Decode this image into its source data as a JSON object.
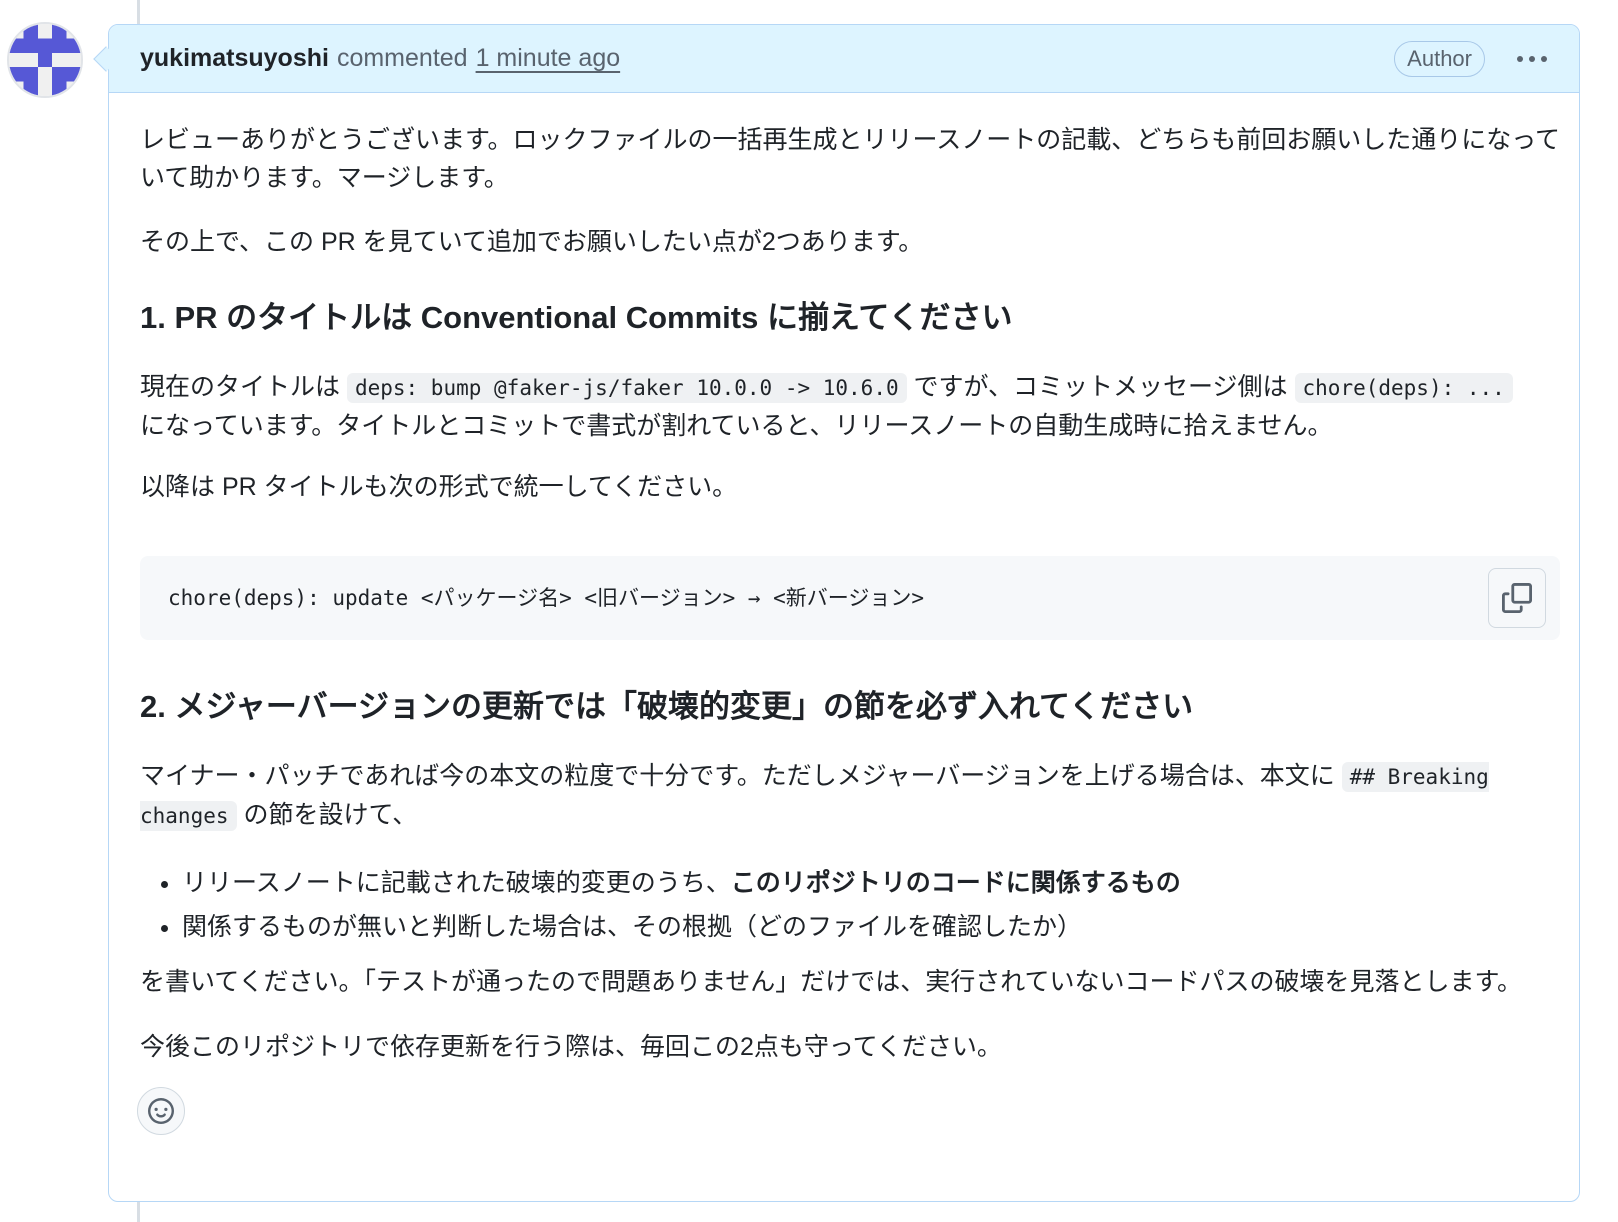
{
  "comment": {
    "author": "yukimatsuyoshi",
    "action": "commented",
    "timestamp": "1 minute ago",
    "badge": "Author",
    "menu_icon": "kebab-horizontal-icon"
  },
  "body": {
    "p1": "レビューありがとうございます。ロックファイルの一括再生成とリリースノートの記載、どちらも前回お願いした通りになっていて助かります。マージします。",
    "p2": "その上で、この PR を見ていて追加でお願いしたい点が2つあります。",
    "h1": "1. PR のタイトルは Conventional Commits に揃えてください",
    "p3_a": "現在のタイトルは ",
    "p3_code1": "deps: bump @faker-js/faker 10.0.0 -> 10.6.0",
    "p3_b": " ですが、コミットメッセージ側は ",
    "p3_code2": "chore(deps): ...",
    "p3_c": " になっています。タイトルとコミットで書式が割れていると、リリースノートの自動生成時に拾えません。",
    "p4": "以降は PR タイトルも次の形式で統一してください。",
    "codeblock": "chore(deps): update <パッケージ名> <旧バージョン> → <新バージョン>",
    "h2": "2. メジャーバージョンの更新では「破壊的変更」の節を必ず入れてください",
    "p5_a": "マイナー・パッチであれば今の本文の粒度で十分です。ただしメジャーバージョンを上げる場合は、本文に ",
    "p5_code": "## Breaking changes",
    "p5_b": " の節を設けて、",
    "li1_a": "リリースノートに記載された破壊的変更のうち、",
    "li1_bold": "このリポジトリのコードに関係するもの",
    "li2": "関係するものが無いと判断した場合は、その根拠（どのファイルを確認したか）",
    "p6": "を書いてください。「テストが通ったので問題ありません」だけでは、実行されていないコードパスの破壊を見落とします。",
    "p7": "今後このリポジトリで依存更新を行う際は、毎回この2点も守ってください。"
  },
  "colors": {
    "header_bg": "#ddf4ff",
    "border": "#b6d7f6",
    "avatar": "#5658d6"
  }
}
